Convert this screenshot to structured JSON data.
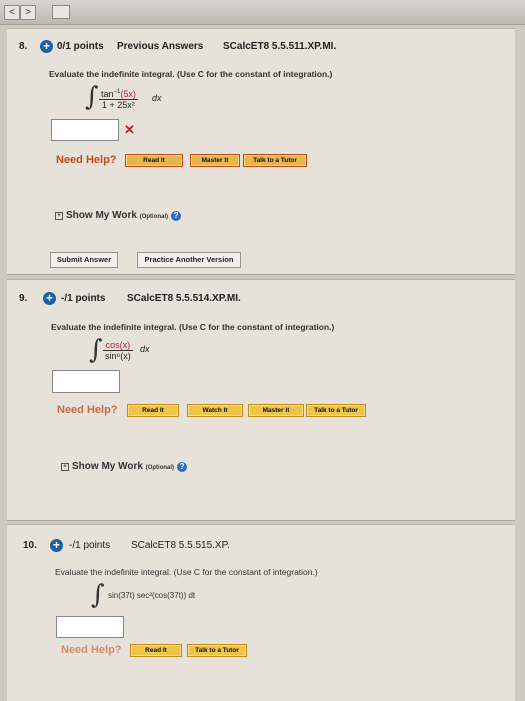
{
  "browser": {
    "back": "<",
    "forward": ">"
  },
  "q8": {
    "number": "8.",
    "points": "0/1 points",
    "previous": "Previous Answers",
    "code": "SCalcET8 5.5.511.XP.MI.",
    "instruction": "Evaluate the indefinite integral. (Use C for the constant of integration.)",
    "numerator_pre": "tan",
    "numerator_sup": "−1",
    "numerator_arg": "(5x)",
    "denominator": "1 + 25x²",
    "dx": "dx",
    "answer_value": "",
    "incorrect_mark": "✕",
    "need_help": "Need Help?",
    "help_buttons": [
      "Read It",
      "Master It",
      "Talk to a Tutor"
    ],
    "show_work": "Show My Work",
    "optional": "(Optional)",
    "submit": "Submit Answer",
    "practice": "Practice Another Version"
  },
  "q9": {
    "number": "9.",
    "points": "-/1 points",
    "code": "SCalcET8 5.5.514.XP.MI.",
    "instruction": "Evaluate the indefinite integral. (Use C for the constant of integration.)",
    "numerator": "cos(x)",
    "denominator": "sin⁶(x)",
    "dx": "dx",
    "answer_value": "",
    "need_help": "Need Help?",
    "help_buttons": [
      "Read It",
      "Watch It",
      "Master It",
      "Talk to a Tutor"
    ],
    "show_work": "Show My Work",
    "optional": "(Optional)"
  },
  "q10": {
    "number": "10.",
    "points": "-/1 points",
    "code": "SCalcET8 5.5.515.XP.",
    "instruction": "Evaluate the indefinite integral. (Use C for the constant of integration.)",
    "integrand": "sin(37t) sec²(cos(37t)) dt",
    "answer_value": "",
    "need_help": "Need Help?",
    "help_buttons": [
      "Read It",
      "Talk to a Tutor"
    ]
  },
  "colors": {
    "accent": "#1b5fa5",
    "need_help": "#c24a1a",
    "help_button": "#ecc54a",
    "incorrect": "#c02020"
  }
}
